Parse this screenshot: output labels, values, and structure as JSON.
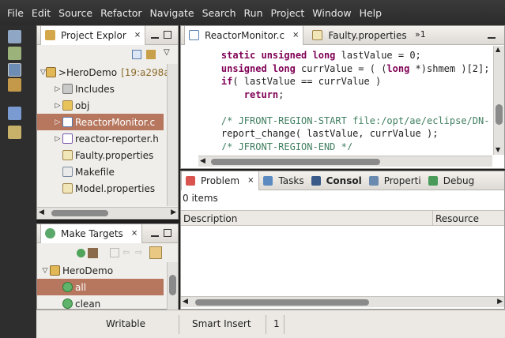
{
  "menu": [
    "File",
    "Edit",
    "Source",
    "Refactor",
    "Navigate",
    "Search",
    "Run",
    "Project",
    "Window",
    "Help"
  ],
  "project_explorer": {
    "title": "Project Explor",
    "tree": [
      {
        "label": ">HeroDemo",
        "suffix": "[19:a298a",
        "icon": "project-icon",
        "depth": 0,
        "expanded": true
      },
      {
        "label": "Includes",
        "icon": "includes-icon",
        "depth": 1,
        "expanded": false
      },
      {
        "label": "obj",
        "icon": "folder-icon",
        "depth": 1,
        "expanded": false
      },
      {
        "label": "ReactorMonitor.c",
        "icon": "c-file-icon",
        "depth": 1,
        "expanded": false,
        "selected": true
      },
      {
        "label": "reactor-reporter.h",
        "icon": "h-file-icon",
        "depth": 1,
        "expanded": false
      },
      {
        "label": "Faulty.properties",
        "icon": "properties-file-icon",
        "depth": 1
      },
      {
        "label": "Makefile",
        "icon": "makefile-icon",
        "depth": 1
      },
      {
        "label": "Model.properties",
        "icon": "properties-file-icon",
        "depth": 1
      }
    ]
  },
  "make_targets": {
    "title": "Make Targets",
    "tree": [
      {
        "label": "HeroDemo",
        "icon": "project-icon",
        "depth": 0,
        "expanded": true
      },
      {
        "label": "all",
        "icon": "target-icon",
        "depth": 1,
        "selected": true
      },
      {
        "label": "clean",
        "icon": "target-icon",
        "depth": 1
      }
    ]
  },
  "editor": {
    "tabs": [
      {
        "label": "ReactorMonitor.c",
        "active": true
      },
      {
        "label": "Faulty.properties",
        "active": false
      }
    ],
    "overflow": "»1",
    "code_lines": [
      [
        {
          "t": "    "
        },
        {
          "t": "static unsigned long",
          "c": "kw"
        },
        {
          "t": " lastValue = 0;"
        }
      ],
      [
        {
          "t": "    "
        },
        {
          "t": "unsigned long",
          "c": "kw"
        },
        {
          "t": " currValue = ( ("
        },
        {
          "t": "long",
          "c": "kw"
        },
        {
          "t": " *)shmem )[2];"
        }
      ],
      [
        {
          "t": "    "
        },
        {
          "t": "if",
          "c": "kw"
        },
        {
          "t": "( lastValue == currValue )"
        }
      ],
      [
        {
          "t": "        "
        },
        {
          "t": "return",
          "c": "kw"
        },
        {
          "t": ";"
        }
      ],
      [
        {
          "t": ""
        }
      ],
      [
        {
          "t": "    /* JFRONT-REGION-START file:/opt/ae/eclipse/DN-",
          "c": "cm"
        }
      ],
      [
        {
          "t": "    report_change( lastValue, currValue );"
        }
      ],
      [
        {
          "t": "    /* JFRONT-REGION-END */",
          "c": "cm"
        }
      ]
    ]
  },
  "bottom_panel": {
    "tabs": [
      {
        "label": "Problem",
        "icon": "problems-icon",
        "active": true,
        "closable": true
      },
      {
        "label": "Tasks",
        "icon": "tasks-icon"
      },
      {
        "label": "Consol",
        "icon": "console-icon",
        "bold": true
      },
      {
        "label": "Properti",
        "icon": "properties-view-icon"
      },
      {
        "label": "Debug",
        "icon": "debug-icon"
      }
    ],
    "count": "0 items",
    "columns": [
      "Description",
      "Resource"
    ]
  },
  "status": {
    "writable": "Writable",
    "insert_mode": "Smart Insert",
    "position": "1"
  },
  "colors": {
    "selection": "#b6775e",
    "keyword": "#7f0055",
    "comment": "#3f7f5f"
  }
}
